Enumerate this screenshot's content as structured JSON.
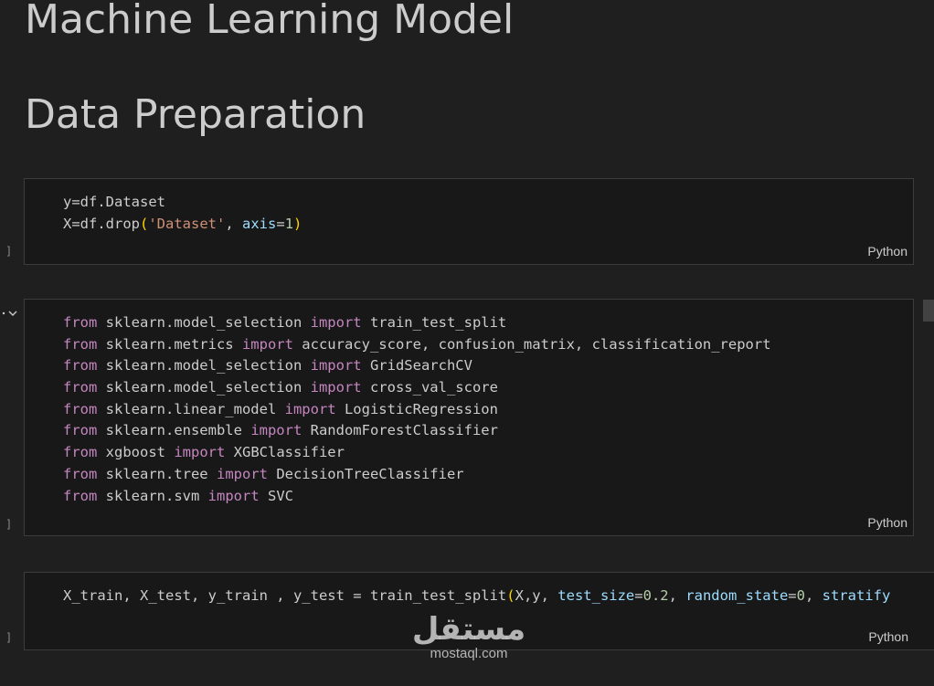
{
  "headings": {
    "h1": "Machine Learning Model",
    "h2": "Data Preparation"
  },
  "cells": [
    {
      "language": "Python",
      "exec_marker": "]",
      "lines": [
        [
          {
            "t": "y=df.Dataset"
          }
        ],
        [
          {
            "t": "X=df.drop"
          },
          {
            "t": "(",
            "c": "paren"
          },
          {
            "t": "'Dataset'",
            "c": "str"
          },
          {
            "t": ", "
          },
          {
            "t": "axis",
            "c": "param"
          },
          {
            "t": "="
          },
          {
            "t": "1",
            "c": "num"
          },
          {
            "t": ")",
            "c": "paren"
          }
        ]
      ]
    },
    {
      "language": "Python",
      "exec_marker": "]",
      "lines": [
        [
          {
            "t": "from",
            "c": "kw"
          },
          {
            "t": " sklearn.model_selection "
          },
          {
            "t": "import",
            "c": "kw"
          },
          {
            "t": " train_test_split"
          }
        ],
        [
          {
            "t": "from",
            "c": "kw"
          },
          {
            "t": " sklearn.metrics "
          },
          {
            "t": "import",
            "c": "kw"
          },
          {
            "t": " accuracy_score, confusion_matrix, classification_report"
          }
        ],
        [
          {
            "t": "from",
            "c": "kw"
          },
          {
            "t": " sklearn.model_selection "
          },
          {
            "t": "import",
            "c": "kw"
          },
          {
            "t": " GridSearchCV"
          }
        ],
        [
          {
            "t": "from",
            "c": "kw"
          },
          {
            "t": " sklearn.model_selection "
          },
          {
            "t": "import",
            "c": "kw"
          },
          {
            "t": " cross_val_score"
          }
        ],
        [
          {
            "t": "from",
            "c": "kw"
          },
          {
            "t": " sklearn.linear_model "
          },
          {
            "t": "import",
            "c": "kw"
          },
          {
            "t": " LogisticRegression"
          }
        ],
        [
          {
            "t": "from",
            "c": "kw"
          },
          {
            "t": " sklearn.ensemble "
          },
          {
            "t": "import",
            "c": "kw"
          },
          {
            "t": " RandomForestClassifier"
          }
        ],
        [
          {
            "t": "from",
            "c": "kw"
          },
          {
            "t": " xgboost "
          },
          {
            "t": "import",
            "c": "kw"
          },
          {
            "t": " XGBClassifier"
          }
        ],
        [
          {
            "t": "from",
            "c": "kw"
          },
          {
            "t": " sklearn.tree "
          },
          {
            "t": "import",
            "c": "kw"
          },
          {
            "t": " DecisionTreeClassifier"
          }
        ],
        [
          {
            "t": "from",
            "c": "kw"
          },
          {
            "t": " sklearn.svm "
          },
          {
            "t": "import",
            "c": "kw"
          },
          {
            "t": " SVC"
          }
        ]
      ]
    },
    {
      "language": "Python",
      "exec_marker": "]",
      "lines": [
        [
          {
            "t": "X_train, X_test, y_train , y_test = train_test_split"
          },
          {
            "t": "(",
            "c": "paren"
          },
          {
            "t": "X,y, "
          },
          {
            "t": "test_size",
            "c": "param"
          },
          {
            "t": "="
          },
          {
            "t": "0.2",
            "c": "num"
          },
          {
            "t": ", "
          },
          {
            "t": "random_state",
            "c": "param"
          },
          {
            "t": "="
          },
          {
            "t": "0",
            "c": "num"
          },
          {
            "t": ", "
          },
          {
            "t": "stratify",
            "c": "param"
          }
        ]
      ]
    }
  ],
  "watermark": {
    "logo": "مستقل",
    "text": "mostaql.com"
  },
  "colors": {
    "background": "#1f1f1f",
    "cell_background": "#181818",
    "keyword": "#c586c0",
    "string": "#ce9178",
    "number": "#b5cea8",
    "parameter": "#9cdcfe",
    "bracket": "#ffd700"
  },
  "icons": {
    "collapse": "chevron-down-icon"
  }
}
